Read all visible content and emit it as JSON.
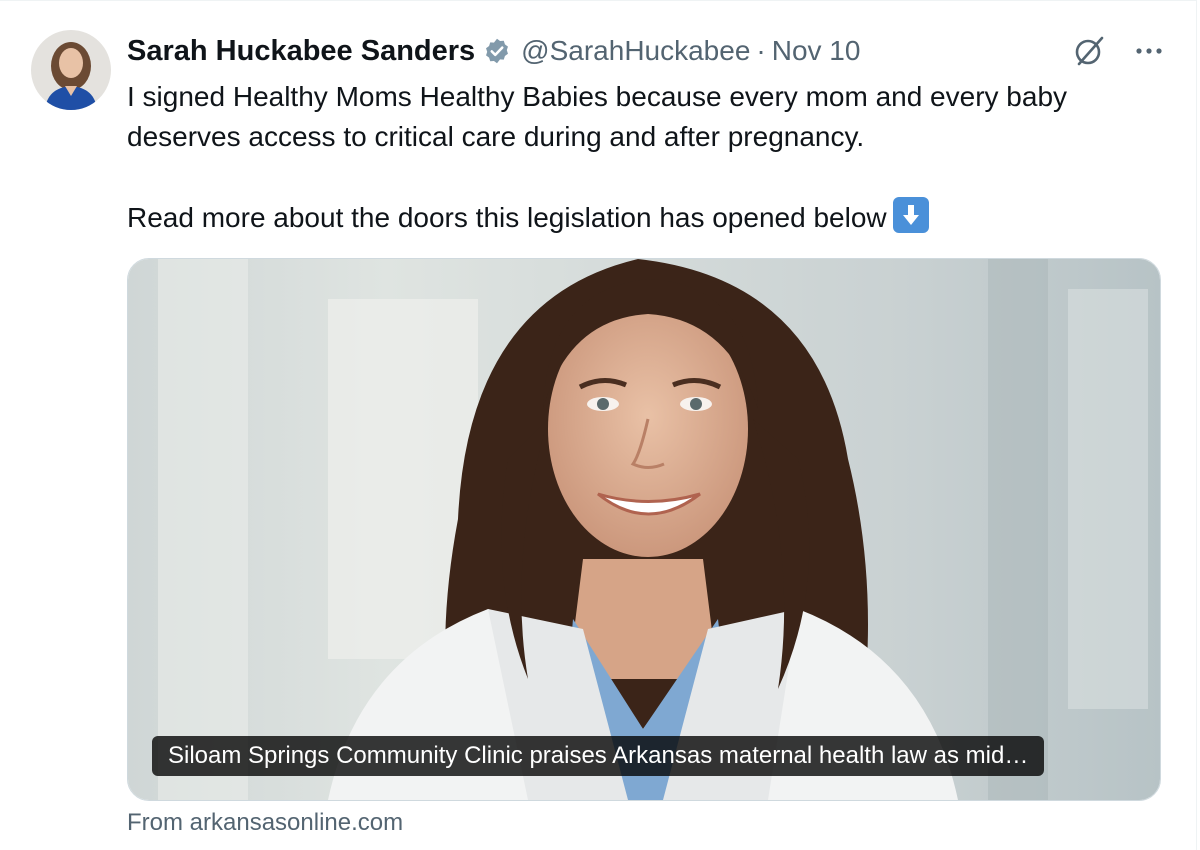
{
  "author": {
    "name": "Sarah Huckabee Sanders",
    "handle": "@SarahHuckabee",
    "separator": "·",
    "date": "Nov 10",
    "verified_icon": "verified-badge-icon"
  },
  "actions": {
    "grok_icon": "grok-icon",
    "more_icon": "more-icon"
  },
  "tweet": {
    "line1": "I signed Healthy Moms Healthy Babies because every mom and every baby deserves access to critical care during and after pregnancy.",
    "line2": "Read more about the doors this legislation has opened below",
    "emoji": "down-arrow-emoji"
  },
  "card": {
    "caption": "Siloam Springs Community Clinic praises Arkansas maternal health law as mid…",
    "source": "From arkansasonline.com"
  },
  "colors": {
    "text": "#0f1419",
    "secondary": "#536471",
    "verified": "#829aab",
    "border": "#cfd9de"
  }
}
